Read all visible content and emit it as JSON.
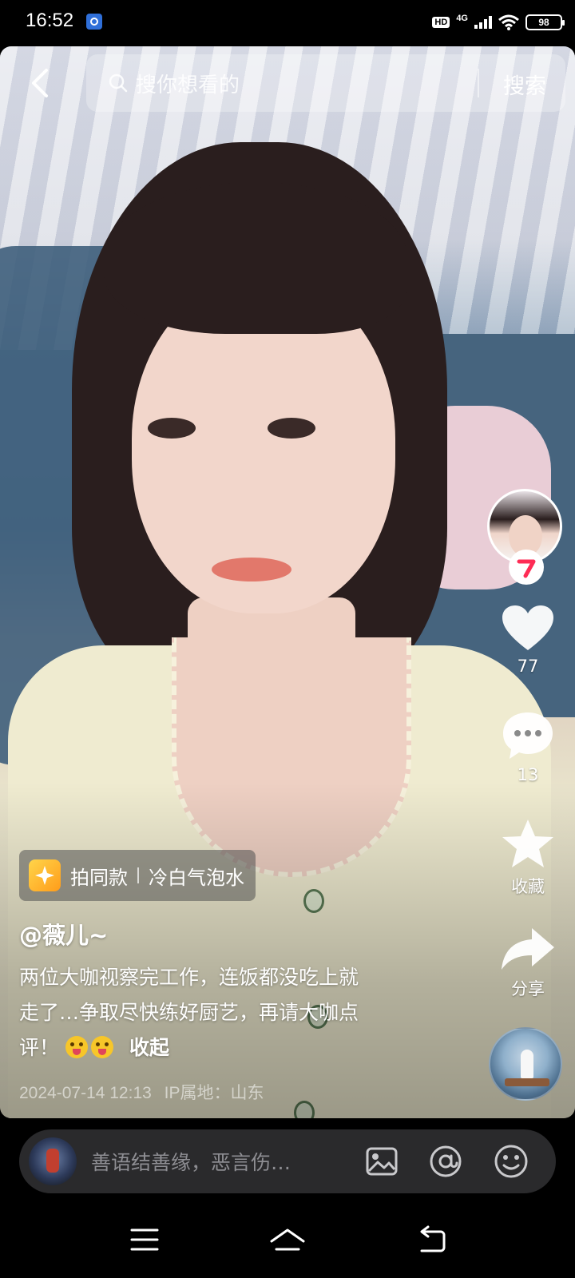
{
  "status_bar": {
    "time": "16:52",
    "hd": "HD",
    "network": "4G",
    "battery": "98"
  },
  "search": {
    "placeholder": "搜你想看的",
    "button_label": "搜索"
  },
  "rail": {
    "likes": "77",
    "comments": "13",
    "favorite_label": "收藏",
    "share_label": "分享",
    "accent_color": "#fe2c55"
  },
  "post": {
    "same_style_label": "拍同款",
    "same_style_song": "冷白气泡水",
    "author": "@薇儿~",
    "caption_line1": "两位大咖视察完工作，连饭都没吃上就",
    "caption_line2": "走了…争取尽快练好厨艺，再请大咖点",
    "caption_line3": "评！",
    "collapse_label": "收起",
    "timestamp": "2024-07-14 12:13",
    "ip_location": "IP属地：山东"
  },
  "comment_bar": {
    "placeholder": "善语结善缘，恶言伤…"
  },
  "icons": {
    "back": "back-arrow-icon",
    "search": "search-icon",
    "heart": "heart-icon",
    "comment": "comment-bubble-icon",
    "star": "star-icon",
    "share": "share-arrow-icon",
    "image": "image-icon",
    "mention": "at-icon",
    "emoji": "smiley-icon"
  }
}
